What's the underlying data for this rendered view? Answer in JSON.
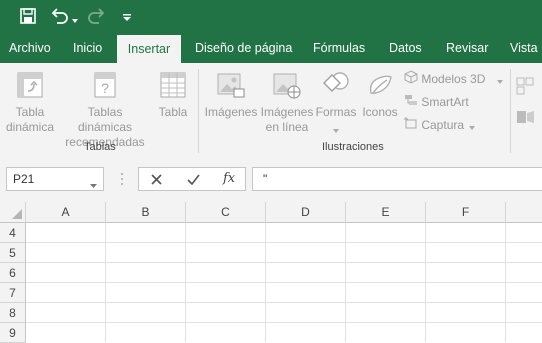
{
  "colors": {
    "accent": "#217346",
    "ribbon_bg": "#f3f3f3",
    "disabled": "#999999"
  },
  "quick_access": {
    "icons": [
      "save-icon",
      "undo-icon",
      "redo-icon",
      "customize-icon"
    ]
  },
  "tabs": [
    {
      "label": "Archivo"
    },
    {
      "label": "Inicio"
    },
    {
      "label": "Insertar",
      "active": true
    },
    {
      "label": "Diseño de página"
    },
    {
      "label": "Fórmulas"
    },
    {
      "label": "Datos"
    },
    {
      "label": "Revisar"
    },
    {
      "label": "Vista"
    }
  ],
  "ribbon": {
    "tablas": {
      "group_label": "Tablas",
      "buttons": [
        {
          "line1": "Tabla",
          "line2": "dinámica"
        },
        {
          "line1": "Tablas dinámicas",
          "line2": "recomendadas"
        },
        {
          "line1": "Tabla",
          "line2": ""
        }
      ]
    },
    "ilustraciones": {
      "group_label": "Ilustraciones",
      "buttons": [
        {
          "line1": "Imágenes",
          "line2": ""
        },
        {
          "line1": "Imágenes",
          "line2": "en línea"
        },
        {
          "line1": "Formas",
          "line2": ""
        },
        {
          "line1": "Iconos",
          "line2": ""
        }
      ],
      "small_buttons": [
        {
          "label": "Modelos 3D"
        },
        {
          "label": "SmartArt"
        },
        {
          "label": "Captura"
        }
      ]
    }
  },
  "formula_bar": {
    "name_box": "P21",
    "formula": "\"",
    "fx_label": "fx"
  },
  "sheet": {
    "columns": [
      "A",
      "B",
      "C",
      "D",
      "E",
      "F"
    ],
    "rows": [
      "4",
      "5",
      "6",
      "7",
      "8",
      "9"
    ]
  }
}
